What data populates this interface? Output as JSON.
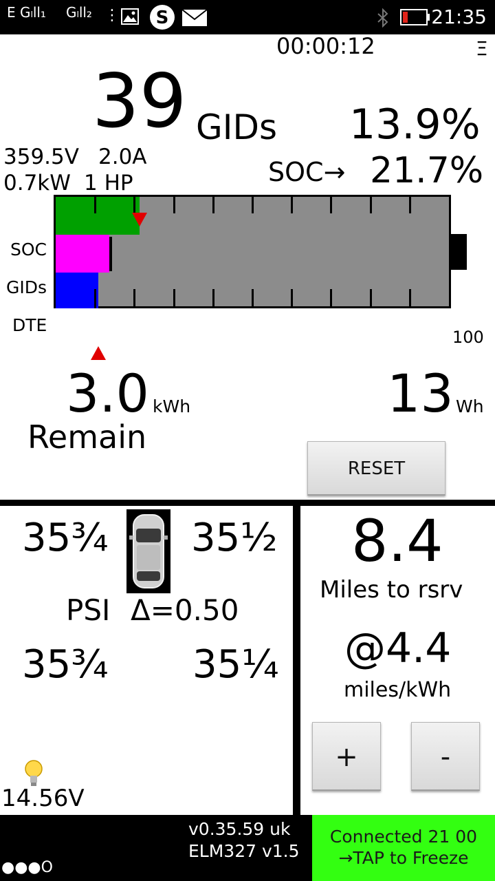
{
  "status_bar": {
    "sim1": "E Gₗll₁",
    "sim2": "Gₗll₂",
    "time": "21:35"
  },
  "timer": "00:00:12",
  "menu_icon": "Ξ",
  "gids": {
    "value": "39",
    "unit": "GIDs",
    "percent": "13.9%"
  },
  "electrical": {
    "voltage": "359.5V",
    "current": "2.0A",
    "power": "0.7kW",
    "hp": "1 HP"
  },
  "soc": {
    "label": "SOC→",
    "value": "21.7%"
  },
  "chart": {
    "row_labels": [
      "SOC",
      "GIDs",
      "DTE"
    ],
    "max_label": "100",
    "soc_fraction": 0.217,
    "gids_fraction": 0.139,
    "dte_fraction": 0.11
  },
  "energy": {
    "value": "3.0",
    "unit": "kWh",
    "label": "Remain"
  },
  "used": {
    "value": "13",
    "unit": "Wh"
  },
  "reset_label": "RESET",
  "tires": {
    "front_left": "35¾",
    "front_right": "35½",
    "rear_left": "35¾",
    "rear_right": "35¼",
    "psi_label": "PSI",
    "delta": "Δ=0.50"
  },
  "aux_voltage": "14.56V",
  "range": {
    "miles": "8.4",
    "miles_label": "Miles to rsrv",
    "efficiency": "@4.4",
    "efficiency_unit": "miles/kWh",
    "plus_label": "+",
    "minus_label": "-"
  },
  "footer": {
    "dots": "●●●O",
    "version": "v0.35.59 uk",
    "elm": "ELM327 v1.5",
    "connected_line1": "Connected 21 00",
    "connected_line2": "→TAP to Freeze"
  }
}
